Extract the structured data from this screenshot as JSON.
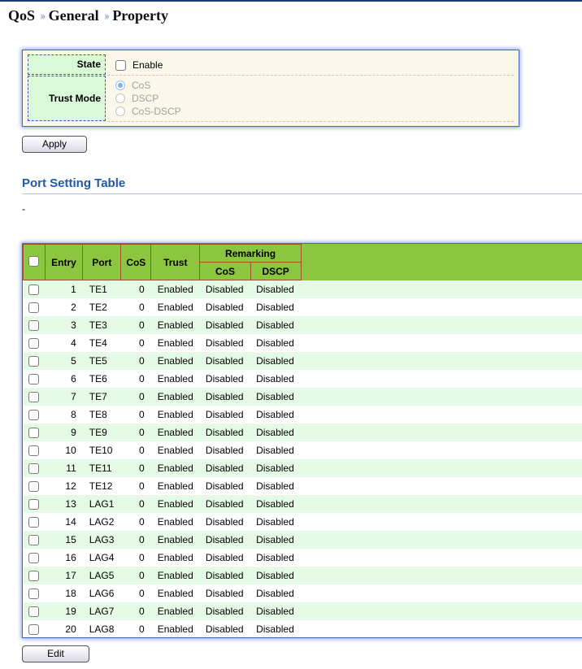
{
  "breadcrumb": {
    "items": [
      "QoS",
      "General",
      "Property"
    ],
    "separator": "››"
  },
  "property": {
    "state_label": "State",
    "state_option": "Enable",
    "state_checked": false,
    "trust_label": "Trust Mode",
    "trust_options": [
      "CoS",
      "DSCP",
      "CoS-DSCP"
    ],
    "trust_selected": "CoS"
  },
  "apply_label": "Apply",
  "port_table": {
    "title": "Port Setting Table",
    "filter_text": "-",
    "headers": {
      "entry": "Entry",
      "port": "Port",
      "cos": "CoS",
      "trust": "Trust",
      "remarking": "Remarking",
      "remark_cos": "CoS",
      "remark_dscp": "DSCP"
    },
    "rows": [
      {
        "entry": "1",
        "port": "TE1",
        "cos": "0",
        "trust": "Enabled",
        "remark_cos": "Disabled",
        "remark_dscp": "Disabled"
      },
      {
        "entry": "2",
        "port": "TE2",
        "cos": "0",
        "trust": "Enabled",
        "remark_cos": "Disabled",
        "remark_dscp": "Disabled"
      },
      {
        "entry": "3",
        "port": "TE3",
        "cos": "0",
        "trust": "Enabled",
        "remark_cos": "Disabled",
        "remark_dscp": "Disabled"
      },
      {
        "entry": "4",
        "port": "TE4",
        "cos": "0",
        "trust": "Enabled",
        "remark_cos": "Disabled",
        "remark_dscp": "Disabled"
      },
      {
        "entry": "5",
        "port": "TE5",
        "cos": "0",
        "trust": "Enabled",
        "remark_cos": "Disabled",
        "remark_dscp": "Disabled"
      },
      {
        "entry": "6",
        "port": "TE6",
        "cos": "0",
        "trust": "Enabled",
        "remark_cos": "Disabled",
        "remark_dscp": "Disabled"
      },
      {
        "entry": "7",
        "port": "TE7",
        "cos": "0",
        "trust": "Enabled",
        "remark_cos": "Disabled",
        "remark_dscp": "Disabled"
      },
      {
        "entry": "8",
        "port": "TE8",
        "cos": "0",
        "trust": "Enabled",
        "remark_cos": "Disabled",
        "remark_dscp": "Disabled"
      },
      {
        "entry": "9",
        "port": "TE9",
        "cos": "0",
        "trust": "Enabled",
        "remark_cos": "Disabled",
        "remark_dscp": "Disabled"
      },
      {
        "entry": "10",
        "port": "TE10",
        "cos": "0",
        "trust": "Enabled",
        "remark_cos": "Disabled",
        "remark_dscp": "Disabled"
      },
      {
        "entry": "11",
        "port": "TE11",
        "cos": "0",
        "trust": "Enabled",
        "remark_cos": "Disabled",
        "remark_dscp": "Disabled"
      },
      {
        "entry": "12",
        "port": "TE12",
        "cos": "0",
        "trust": "Enabled",
        "remark_cos": "Disabled",
        "remark_dscp": "Disabled"
      },
      {
        "entry": "13",
        "port": "LAG1",
        "cos": "0",
        "trust": "Enabled",
        "remark_cos": "Disabled",
        "remark_dscp": "Disabled"
      },
      {
        "entry": "14",
        "port": "LAG2",
        "cos": "0",
        "trust": "Enabled",
        "remark_cos": "Disabled",
        "remark_dscp": "Disabled"
      },
      {
        "entry": "15",
        "port": "LAG3",
        "cos": "0",
        "trust": "Enabled",
        "remark_cos": "Disabled",
        "remark_dscp": "Disabled"
      },
      {
        "entry": "16",
        "port": "LAG4",
        "cos": "0",
        "trust": "Enabled",
        "remark_cos": "Disabled",
        "remark_dscp": "Disabled"
      },
      {
        "entry": "17",
        "port": "LAG5",
        "cos": "0",
        "trust": "Enabled",
        "remark_cos": "Disabled",
        "remark_dscp": "Disabled"
      },
      {
        "entry": "18",
        "port": "LAG6",
        "cos": "0",
        "trust": "Enabled",
        "remark_cos": "Disabled",
        "remark_dscp": "Disabled"
      },
      {
        "entry": "19",
        "port": "LAG7",
        "cos": "0",
        "trust": "Enabled",
        "remark_cos": "Disabled",
        "remark_dscp": "Disabled"
      },
      {
        "entry": "20",
        "port": "LAG8",
        "cos": "0",
        "trust": "Enabled",
        "remark_cos": "Disabled",
        "remark_dscp": "Disabled"
      }
    ]
  },
  "edit_label": "Edit",
  "colors": {
    "header_green": "#8cc63f",
    "row_alt": "#e4fae4",
    "title_blue": "#1f5aa6",
    "panel_bg": "#fbf8e9"
  }
}
